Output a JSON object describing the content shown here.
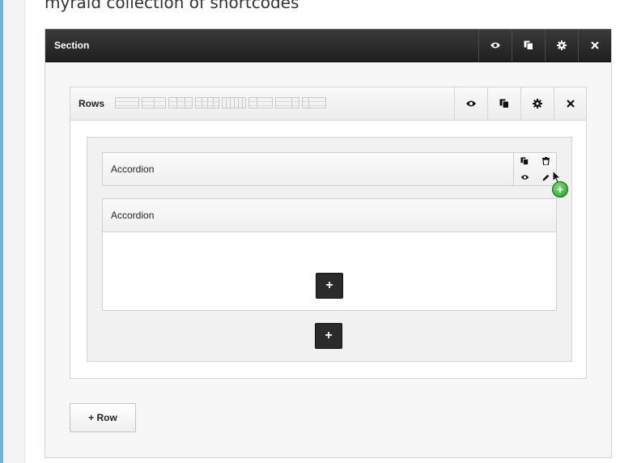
{
  "page": {
    "heading": "myraid collection of shortcodes"
  },
  "section": {
    "title": "Section",
    "buttons": [
      "eye-icon",
      "clone-icon",
      "gear-icon",
      "close-icon"
    ]
  },
  "rows_panel": {
    "title": "Rows",
    "layout_icons": [
      "layout-1-col",
      "layout-2-col",
      "layout-3-col",
      "layout-4-col",
      "layout-6-col",
      "layout-1-3-2-3",
      "layout-2-3-1-3",
      "layout-1-4-3-4"
    ],
    "buttons": [
      "eye-icon",
      "clone-icon",
      "gear-icon",
      "close-icon"
    ]
  },
  "accordion_collapsed": {
    "title": "Accordion",
    "buttons": [
      "clone-icon",
      "trash-icon",
      "eye-icon",
      "pencil-icon"
    ]
  },
  "accordion_expanded": {
    "title": "Accordion",
    "add_label": "+"
  },
  "column": {
    "add_label": "+"
  },
  "add_row_button": {
    "label": "+ Row"
  },
  "cursor_badge": {
    "label": "+"
  }
}
